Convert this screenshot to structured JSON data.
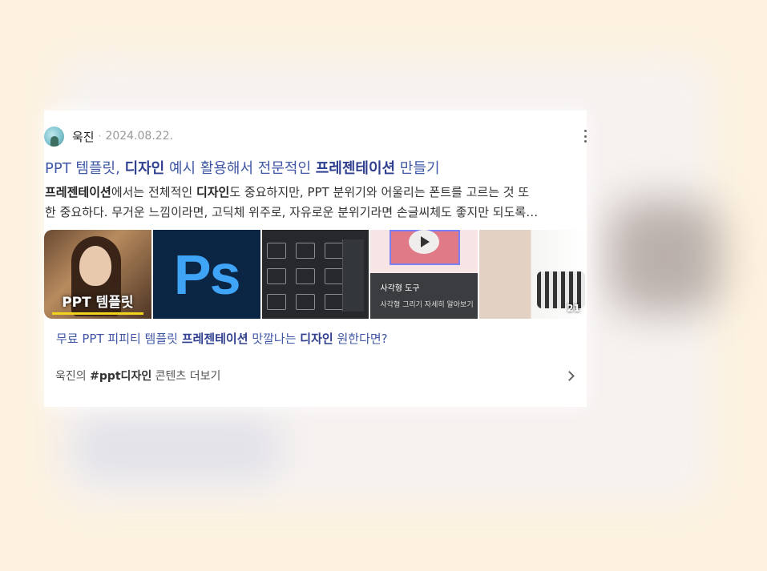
{
  "post": {
    "author": "욱진",
    "separator": "·",
    "date": "2024.08.22.",
    "title_parts": [
      "PPT 템플릿, ",
      "디자인",
      " 예시 활용해서 전문적인 ",
      "프레젠테이션",
      " 만들기"
    ],
    "desc_line1_parts": [
      "프레젠테이션",
      "에서는 전체적인 ",
      "디자인",
      "도 중요하지만, PPT 분위기와 어울리는 폰트를 고르는 것 또"
    ],
    "desc_line2": "한 중요하다. 무거운 느낌이라면, 고딕체 위주로, 자유로운 분위기라면 손글씨체도 좋지만 되도록…",
    "thumbnails": [
      {
        "caption": "PPT 템플릿"
      },
      {
        "caption": "Ps"
      },
      {
        "caption": ""
      },
      {
        "caption": "사각형 도구",
        "sub": "사각형 그리기  자세히 알아보기"
      },
      {
        "caption": "21"
      }
    ]
  },
  "related": {
    "parts": [
      "무료 PPT 피피티 템플릿 ",
      "프레젠테이션",
      " 맛깔나는 ",
      "디자인",
      " 원한다면?"
    ]
  },
  "more": {
    "prefix": "욱진의 ",
    "tag": "#ppt디자인",
    "suffix": " 콘텐츠 더보기"
  },
  "colors": {
    "link": "#4057a6",
    "background": "#fdf1df"
  },
  "icons": [
    "more-vertical-icon",
    "chevron-right-icon",
    "play-icon"
  ]
}
